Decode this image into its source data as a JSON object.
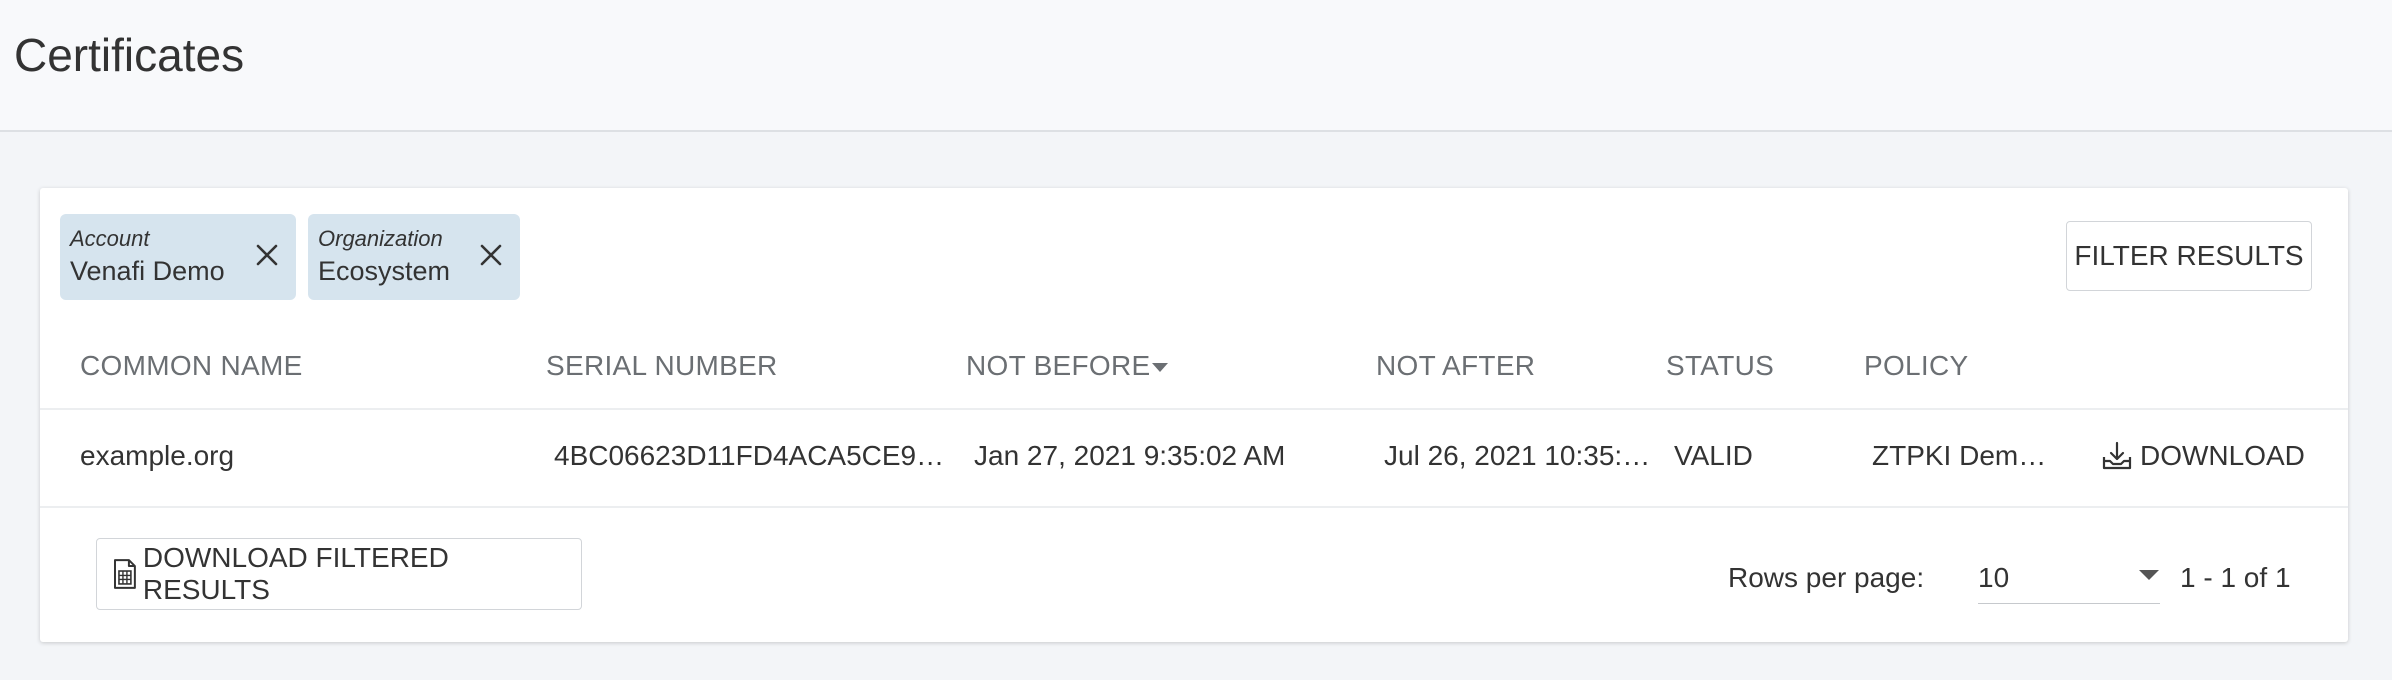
{
  "page": {
    "title": "Certificates"
  },
  "filters": {
    "chips": [
      {
        "label": "Account",
        "value": "Venafi Demo"
      },
      {
        "label": "Organization",
        "value": "Ecosystem"
      }
    ],
    "filter_button": "FILTER RESULTS"
  },
  "table": {
    "columns": [
      "COMMON NAME",
      "SERIAL NUMBER",
      "NOT BEFORE",
      "NOT AFTER",
      "STATUS",
      "POLICY"
    ],
    "sort": {
      "column": "NOT BEFORE",
      "direction": "descending"
    },
    "rows": [
      {
        "common_name": "example.org",
        "serial_number": "4BC06623D11FD4ACA5CE96…",
        "not_before": "Jan 27, 2021 9:35:02 AM",
        "not_after": "Jul 26, 2021 10:35:…",
        "status": "VALID",
        "policy": "ZTPKI Dem…",
        "action": "DOWNLOAD"
      }
    ]
  },
  "footer": {
    "download_filtered": "DOWNLOAD FILTERED RESULTS",
    "rows_per_page_label": "Rows per page:",
    "rows_per_page_value": "10",
    "range": "1 - 1 of 1"
  },
  "icons": {
    "chip_close": "close-icon",
    "sort": "caret-down-icon",
    "download": "download-tray-icon",
    "spreadsheet": "spreadsheet-file-icon",
    "select": "caret-down-icon"
  },
  "colors": {
    "background": "#f3f5f8",
    "header": "#f8f9fb",
    "chip": "#d6e4ee",
    "header_text": "#6b6f73",
    "text": "#333333"
  }
}
